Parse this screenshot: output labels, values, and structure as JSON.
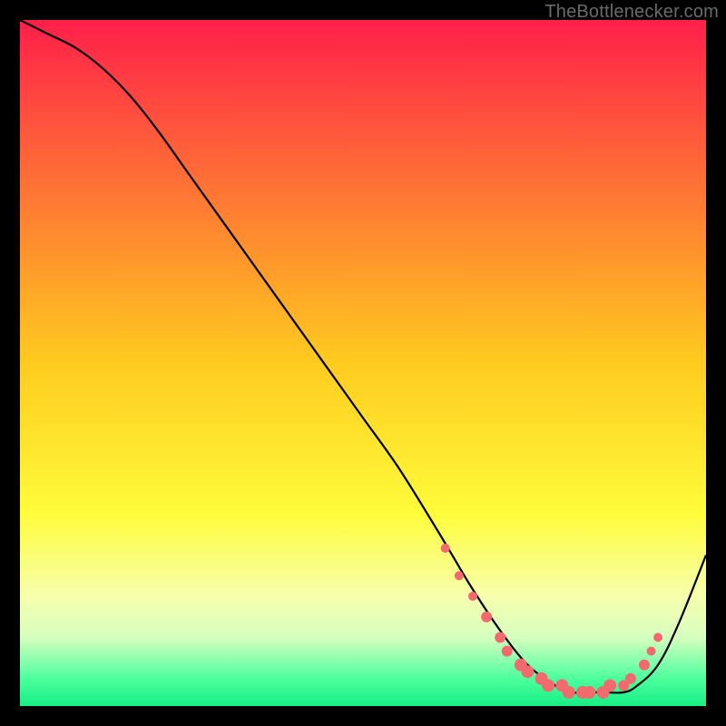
{
  "attribution": "TheBottlenecker.com",
  "chart_data": {
    "type": "line",
    "title": "",
    "xlabel": "",
    "ylabel": "",
    "xlim": [
      0,
      100
    ],
    "ylim": [
      0,
      100
    ],
    "grid": false,
    "background_gradient": {
      "stops": [
        {
          "offset": 0.0,
          "color": "#ff1f4a"
        },
        {
          "offset": 0.5,
          "color": "#ffcb1f"
        },
        {
          "offset": 0.72,
          "color": "#fffc3b"
        },
        {
          "offset": 0.84,
          "color": "#f7ffad"
        },
        {
          "offset": 0.9,
          "color": "#d6ffbf"
        },
        {
          "offset": 0.96,
          "color": "#4dff9e"
        },
        {
          "offset": 1.0,
          "color": "#17ef85"
        }
      ]
    },
    "series": [
      {
        "name": "bottleneck-curve",
        "color": "#000000",
        "width": 2.2,
        "x": [
          0,
          4,
          8,
          12,
          16,
          20,
          25,
          30,
          35,
          40,
          45,
          50,
          55,
          60,
          63,
          66,
          70,
          74,
          78,
          80,
          82,
          85,
          88,
          90,
          93,
          96,
          100
        ],
        "y": [
          100,
          98,
          96,
          93,
          89,
          84,
          77,
          70,
          63,
          56,
          49,
          42,
          35,
          27,
          22,
          17,
          11,
          6,
          3,
          2,
          2,
          2,
          2,
          3,
          6,
          12,
          22
        ]
      }
    ],
    "markers": {
      "name": "sweet-spot",
      "color": "#f26a6e",
      "radius_min": 4,
      "radius_max": 7,
      "points": [
        {
          "x": 62,
          "y": 23,
          "r": 5
        },
        {
          "x": 64,
          "y": 19,
          "r": 5
        },
        {
          "x": 66,
          "y": 16,
          "r": 5
        },
        {
          "x": 68,
          "y": 13,
          "r": 6
        },
        {
          "x": 70,
          "y": 10,
          "r": 6
        },
        {
          "x": 71,
          "y": 8,
          "r": 6
        },
        {
          "x": 73,
          "y": 6,
          "r": 7
        },
        {
          "x": 74,
          "y": 5,
          "r": 7
        },
        {
          "x": 76,
          "y": 4,
          "r": 7
        },
        {
          "x": 77,
          "y": 3,
          "r": 7
        },
        {
          "x": 79,
          "y": 3,
          "r": 7
        },
        {
          "x": 80,
          "y": 2,
          "r": 7
        },
        {
          "x": 82,
          "y": 2,
          "r": 7
        },
        {
          "x": 83,
          "y": 2,
          "r": 7
        },
        {
          "x": 85,
          "y": 2,
          "r": 7
        },
        {
          "x": 86,
          "y": 3,
          "r": 7
        },
        {
          "x": 88,
          "y": 3,
          "r": 6
        },
        {
          "x": 89,
          "y": 4,
          "r": 6
        },
        {
          "x": 91,
          "y": 6,
          "r": 6
        },
        {
          "x": 92,
          "y": 8,
          "r": 5
        },
        {
          "x": 93,
          "y": 10,
          "r": 5
        }
      ]
    }
  }
}
